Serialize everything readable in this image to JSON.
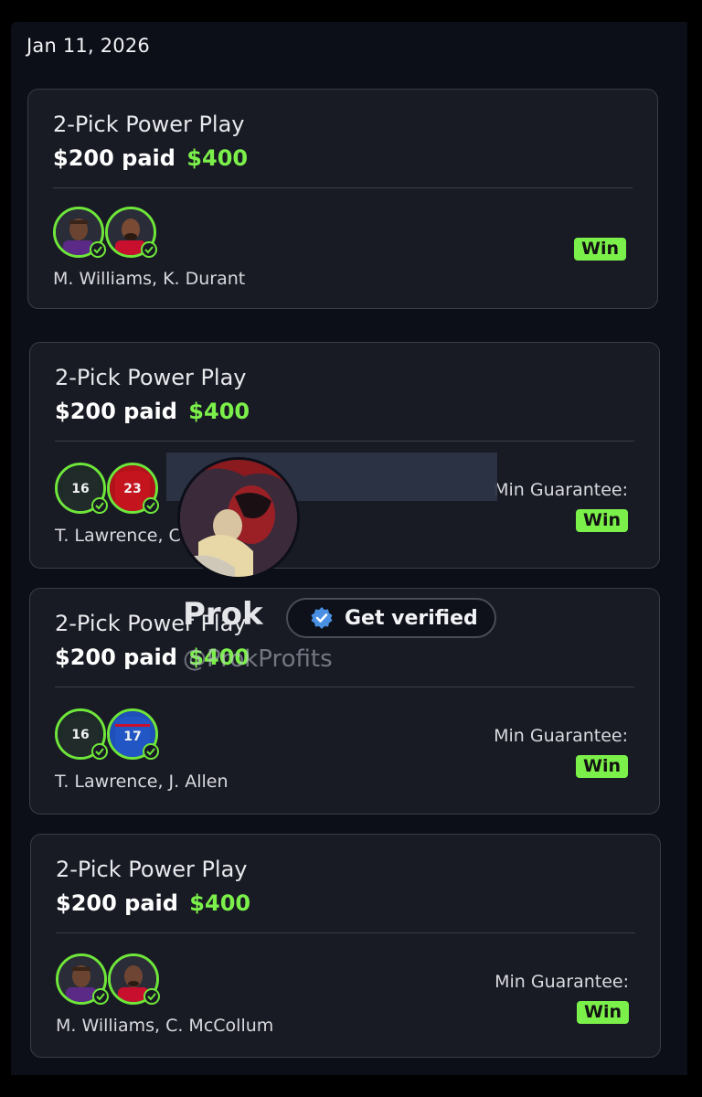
{
  "date": "Jan 11, 2026",
  "cards": [
    {
      "title": "2-Pick Power Play",
      "stake": "$200 paid",
      "payout": "$400",
      "players": "M. Williams, K. Durant",
      "guarantee": "",
      "result": "Win",
      "avatars": [
        {
          "type": "headshot",
          "skin": "#6a4430",
          "jersey": "#5b2a86"
        },
        {
          "type": "headshot",
          "skin": "#7a4a34",
          "jersey": "#c8102e"
        }
      ]
    },
    {
      "title": "2-Pick Power Play",
      "stake": "$200 paid",
      "payout": "$400",
      "players": "T. Lawrence, C. McCaffrey",
      "guarantee": "Min Guarantee:",
      "result": "Win",
      "avatars": [
        {
          "type": "jersey",
          "number": "16",
          "jersey": "#1e2a28"
        },
        {
          "type": "jersey",
          "number": "23",
          "jersey": "#b3121b"
        }
      ]
    },
    {
      "title": "2-Pick Power Play",
      "stake": "$200 paid",
      "payout": "$400",
      "players": "T. Lawrence, J. Allen",
      "guarantee": "Min Guarantee:",
      "result": "Win",
      "avatars": [
        {
          "type": "jersey",
          "number": "16",
          "jersey": "#1e2a28"
        },
        {
          "type": "jersey",
          "number": "17",
          "jersey": "#1f4fb8"
        }
      ]
    },
    {
      "title": "2-Pick Power Play",
      "stake": "$200 paid",
      "payout": "$400",
      "players": "M. Williams, C. McCollum",
      "guarantee": "Min Guarantee:",
      "result": "Win",
      "avatars": [
        {
          "type": "headshot",
          "skin": "#6a4430",
          "jersey": "#5b2a86"
        },
        {
          "type": "headshot",
          "skin": "#6e4532",
          "jersey": "#c8102e"
        }
      ]
    }
  ],
  "overlay": {
    "name": "Prok",
    "handle": "@ProkProfits",
    "verify_label": "Get verified",
    "verify_icon": "verified-badge-icon"
  },
  "colors": {
    "accent_green": "#7cf04a",
    "card_bg": "#181a24",
    "page_bg": "#0c0e18",
    "verify_blue": "#4a90e2"
  }
}
